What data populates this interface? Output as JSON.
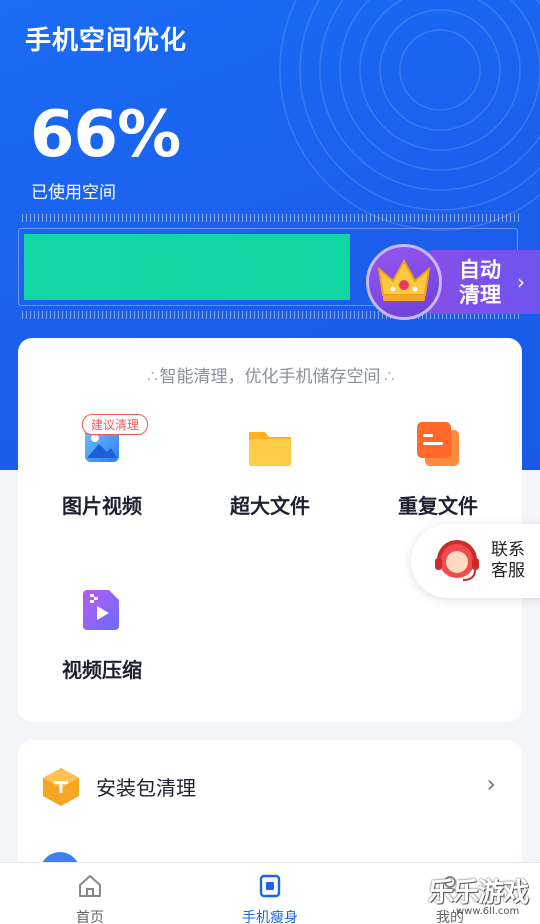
{
  "header": {
    "title": "手机空间优化"
  },
  "storage": {
    "percent": "66%",
    "label": "已使用空间",
    "used_fraction": 0.66
  },
  "auto_clean": {
    "label": "自动清理",
    "chevron": "›"
  },
  "smart": {
    "subtitle": "智能清理，优化手机储存空间"
  },
  "features": [
    {
      "label": "图片视频",
      "icon": "image-icon"
    },
    {
      "label": "超大文件",
      "icon": "folder-icon"
    },
    {
      "label": "重复文件",
      "icon": "duplicate-file-icon"
    },
    {
      "label": "视频压缩",
      "icon": "video-compress-icon"
    }
  ],
  "badge": {
    "label": "建议清理"
  },
  "customer_service": {
    "label": "联系客服"
  },
  "list": {
    "apk_label": "安装包清理",
    "chevron": "›"
  },
  "tabs": [
    {
      "label": "首页",
      "icon": "home-icon",
      "active": false
    },
    {
      "label": "手机瘦身",
      "icon": "phone-slim-icon",
      "active": true
    },
    {
      "label": "我的",
      "icon": "profile-icon",
      "active": false
    }
  ],
  "watermark": {
    "text": "乐乐游戏",
    "url": "www.6ll.com"
  },
  "colors": {
    "primary": "#1a66f0",
    "bar": "#12d7a4",
    "purple": "#7b4ff0",
    "badge": "#f25a5a"
  }
}
